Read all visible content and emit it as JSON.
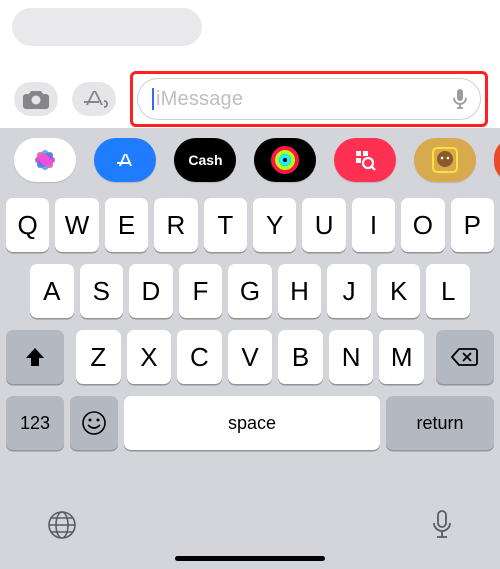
{
  "conversation": {
    "last_bubble_empty": true
  },
  "composer": {
    "camera_icon": "camera",
    "apps_icon": "app-store",
    "input": {
      "value": "",
      "placeholder": "iMessage"
    },
    "mic_icon": "microphone",
    "highlighted": true
  },
  "app_strip": {
    "items": [
      {
        "name": "photos",
        "label": ""
      },
      {
        "name": "appstore",
        "label": ""
      },
      {
        "name": "applecash",
        "label": "Cash"
      },
      {
        "name": "activity",
        "label": ""
      },
      {
        "name": "search",
        "label": ""
      },
      {
        "name": "memoji-1",
        "label": ""
      },
      {
        "name": "memoji-2",
        "label": ""
      }
    ]
  },
  "keyboard": {
    "row1": [
      "Q",
      "W",
      "E",
      "R",
      "T",
      "Y",
      "U",
      "I",
      "O",
      "P"
    ],
    "row2": [
      "A",
      "S",
      "D",
      "F",
      "G",
      "H",
      "J",
      "K",
      "L"
    ],
    "row3": [
      "Z",
      "X",
      "C",
      "V",
      "B",
      "N",
      "M"
    ],
    "numbers_key": "123",
    "emoji_key": "☺",
    "space_key": "space",
    "return_key": "return"
  },
  "bottom": {
    "globe_icon": "globe",
    "dictation_icon": "microphone"
  }
}
